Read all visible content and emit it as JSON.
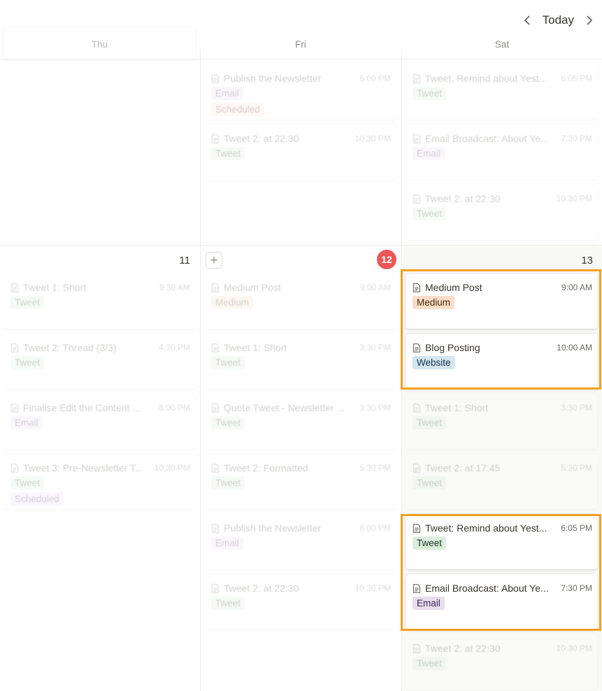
{
  "nav": {
    "today_label": "Today"
  },
  "days": [
    "Thu",
    "Fri",
    "Sat"
  ],
  "week2": {
    "thu_num": "11",
    "fri_num": "12",
    "sat_num": "13",
    "add_label": "+"
  },
  "tag_colors": {
    "Tweet": "#dbeddb",
    "Medium": "#fadec9",
    "Website": "#d3e5ef",
    "Email": "#e8deee",
    "Scheduled": "#ffe2dd"
  },
  "highlight_color": "#f4a11e",
  "events": {
    "fri_w1": [
      {
        "title": "Publish the Newsletter",
        "time": "6:00 PM",
        "tags": [
          "Email",
          "Scheduled"
        ]
      },
      {
        "title": "Tweet 2: at 22:30",
        "time": "10:30 PM",
        "tags": [
          "Tweet"
        ]
      }
    ],
    "sat_w1": [
      {
        "title": "Tweet: Remind about Yest...",
        "time": "6:05 PM",
        "tags": [
          "Tweet"
        ]
      },
      {
        "title": "Email Broadcast: About Ye...",
        "time": "7:30 PM",
        "tags": [
          "Email"
        ]
      },
      {
        "title": "Tweet 2: at 22:30",
        "time": "10:30 PM",
        "tags": [
          "Tweet"
        ]
      }
    ],
    "thu_w2": [
      {
        "title": "Tweet 1: Short",
        "time": "9:30 AM",
        "tags": [
          "Tweet"
        ]
      },
      {
        "title": "Tweet 2: Thread (3/3)",
        "time": "4:30 PM",
        "tags": [
          "Tweet"
        ]
      },
      {
        "title": "Finalise Edit the Content ...",
        "time": "6:00 PM",
        "tags": [
          "Email"
        ]
      },
      {
        "title": "Tweet 3: Pre-Newsletter T...",
        "time": "10:30 PM",
        "tags": [
          "Tweet",
          "Scheduled"
        ]
      }
    ],
    "fri_w2": [
      {
        "title": "Medium Post",
        "time": "9:00 AM",
        "tags": [
          "Medium"
        ]
      },
      {
        "title": "Tweet 1: Short",
        "time": "3:30 PM",
        "tags": [
          "Tweet"
        ]
      },
      {
        "title": "Quote Tweet - Newsletter ...",
        "time": "3:30 PM",
        "tags": [
          "Tweet"
        ]
      },
      {
        "title": "Tweet 2: Formatted",
        "time": "5:30 PM",
        "tags": [
          "Tweet"
        ]
      },
      {
        "title": "Publish the Newsletter",
        "time": "6:00 PM",
        "tags": [
          "Email"
        ]
      },
      {
        "title": "Tweet 2: at 22:30",
        "time": "10:30 PM",
        "tags": [
          "Tweet"
        ]
      }
    ],
    "sat_w2": [
      {
        "title": "Medium Post",
        "time": "9:00 AM",
        "tags": [
          "Medium"
        ]
      },
      {
        "title": "Blog Posting",
        "time": "10:00 AM",
        "tags": [
          "Website"
        ]
      },
      {
        "title": "Tweet 1: Short",
        "time": "3:30 PM",
        "tags": [
          "Tweet"
        ]
      },
      {
        "title": "Tweet 2: at 17:45",
        "time": "5:30 PM",
        "tags": [
          "Tweet"
        ]
      },
      {
        "title": "Tweet: Remind about Yest...",
        "time": "6:05 PM",
        "tags": [
          "Tweet"
        ]
      },
      {
        "title": "Email Broadcast: About Ye...",
        "time": "7:30 PM",
        "tags": [
          "Email"
        ]
      },
      {
        "title": "Tweet 2: at 22:30",
        "time": "10:30 PM",
        "tags": [
          "Tweet"
        ]
      }
    ]
  }
}
